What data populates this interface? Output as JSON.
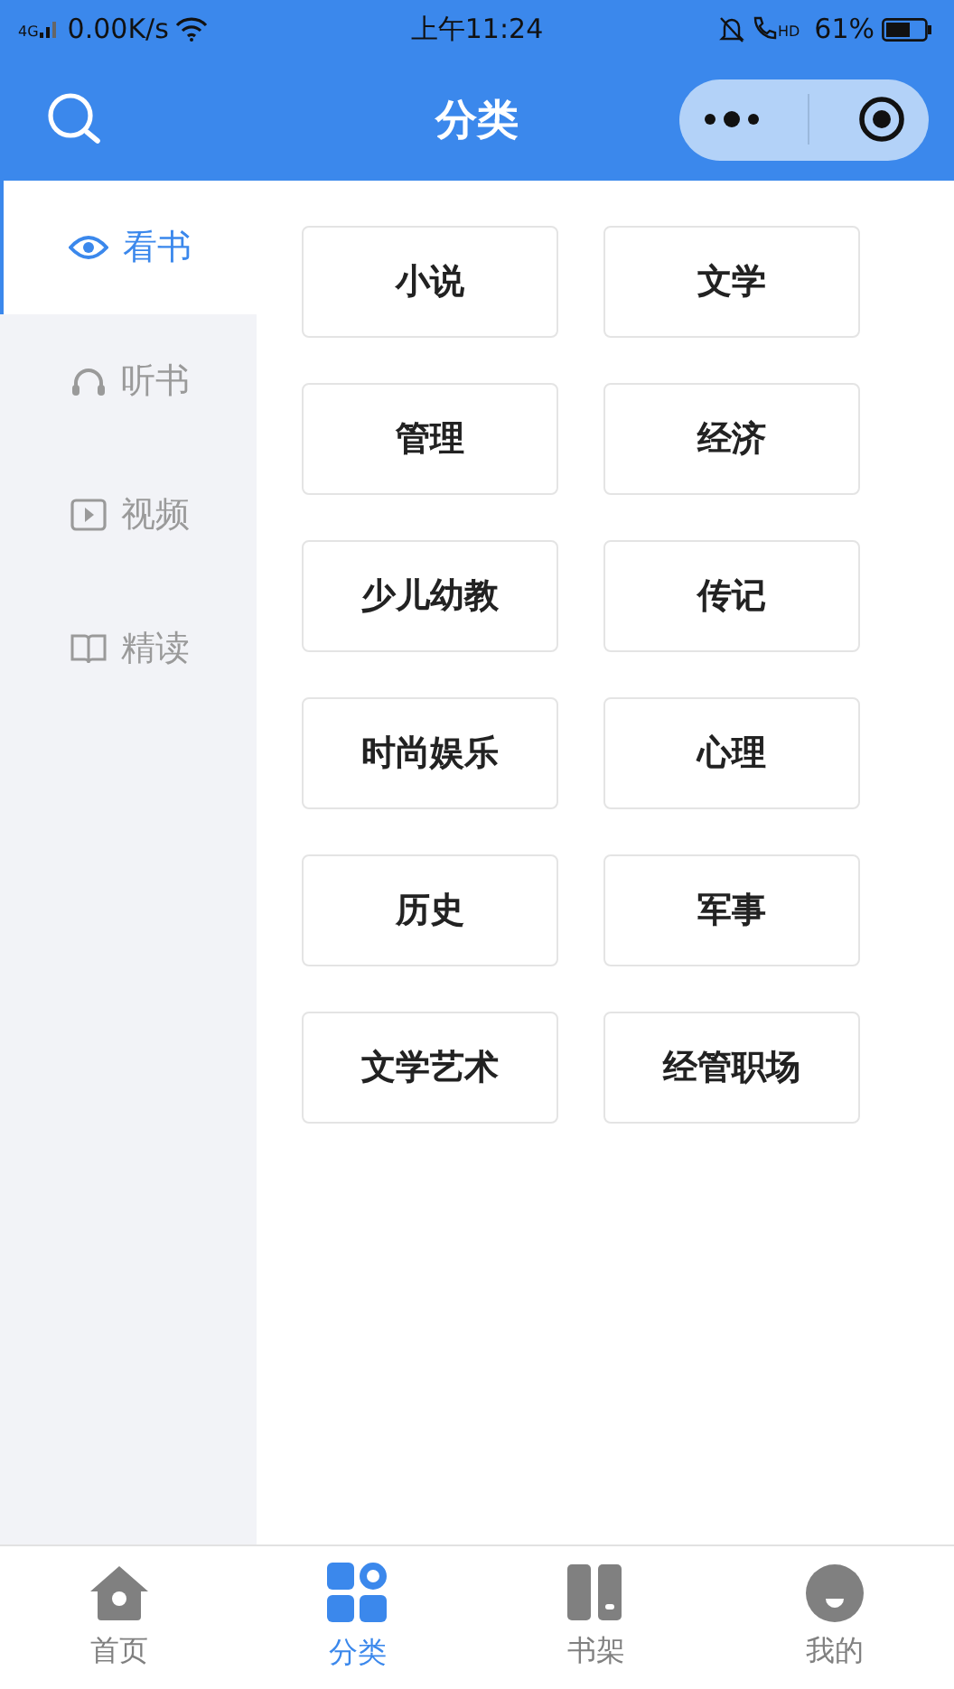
{
  "status_bar": {
    "network": "4G",
    "speed": "0.00K/s",
    "time": "上午11:24",
    "call_label": "HD",
    "battery": "61%"
  },
  "header": {
    "title": "分类"
  },
  "sidebar": {
    "items": [
      {
        "label": "看书",
        "kind": "eye",
        "selected": true
      },
      {
        "label": "听书",
        "kind": "headphones",
        "selected": false
      },
      {
        "label": "视频",
        "kind": "video",
        "selected": false
      },
      {
        "label": "精读",
        "kind": "book",
        "selected": false
      }
    ]
  },
  "categories": [
    "小说",
    "文学",
    "管理",
    "经济",
    "少儿幼教",
    "传记",
    "时尚娱乐",
    "心理",
    "历史",
    "军事",
    "文学艺术",
    "经管职场"
  ],
  "tab_bar": {
    "items": [
      {
        "label": "首页",
        "kind": "home",
        "selected": false
      },
      {
        "label": "分类",
        "kind": "grid",
        "selected": true
      },
      {
        "label": "书架",
        "kind": "shelf",
        "selected": false
      },
      {
        "label": "我的",
        "kind": "profile",
        "selected": false
      }
    ]
  }
}
